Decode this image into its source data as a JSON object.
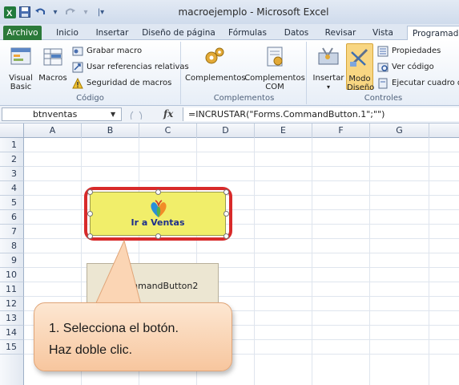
{
  "window": {
    "title": "macroejemplo  -  Microsoft Excel"
  },
  "quick_access": {
    "icons": [
      "excel-icon",
      "save-icon",
      "undo-icon",
      "redo-icon",
      "customize-icon"
    ]
  },
  "tabs": [
    {
      "label": "Archivo"
    },
    {
      "label": "Inicio"
    },
    {
      "label": "Insertar"
    },
    {
      "label": "Diseño de página"
    },
    {
      "label": "Fórmulas"
    },
    {
      "label": "Datos"
    },
    {
      "label": "Revisar"
    },
    {
      "label": "Vista"
    },
    {
      "label": "Programador"
    }
  ],
  "ribbon": {
    "codigo": {
      "label": "Código",
      "visual_basic": "Visual Basic",
      "macros": "Macros",
      "grabar_macro": "Grabar macro",
      "usar_referencias": "Usar referencias relativas",
      "seguridad_macros": "Seguridad de macros"
    },
    "complementos": {
      "label": "Complementos",
      "complementos": "Complementos",
      "complementos_com_1": "Complementos",
      "complementos_com_2": "COM"
    },
    "controles": {
      "label": "Controles",
      "insertar": "Insertar",
      "modo_diseno_1": "Modo",
      "modo_diseno_2": "Diseño",
      "propiedades": "Propiedades",
      "ver_codigo": "Ver código",
      "ejecutar_cuadro": "Ejecutar cuadro de"
    }
  },
  "formula_bar": {
    "name_box": "btnventas",
    "fx": "fx",
    "formula": "=INCRUSTAR(\"Forms.CommandButton.1\";\"\")"
  },
  "sheet": {
    "columns": [
      "A",
      "B",
      "C",
      "D",
      "E",
      "F",
      "G"
    ],
    "rows": [
      "1",
      "2",
      "3",
      "4",
      "5",
      "6",
      "7",
      "8",
      "9",
      "10",
      "11",
      "12",
      "13",
      "14",
      "15"
    ]
  },
  "buttons": {
    "ventas_label": "Ir a Ventas",
    "cmd2_label": "CommandButton2"
  },
  "callout": {
    "line1": "1. Selecciona el botón.",
    "line2": "Haz doble clic."
  },
  "colors": {
    "accent_red": "#d82a2a",
    "button_yellow": "#f1ee6a",
    "archivo_green": "#2c7a3a",
    "callout_fill": "#f7c69e"
  }
}
